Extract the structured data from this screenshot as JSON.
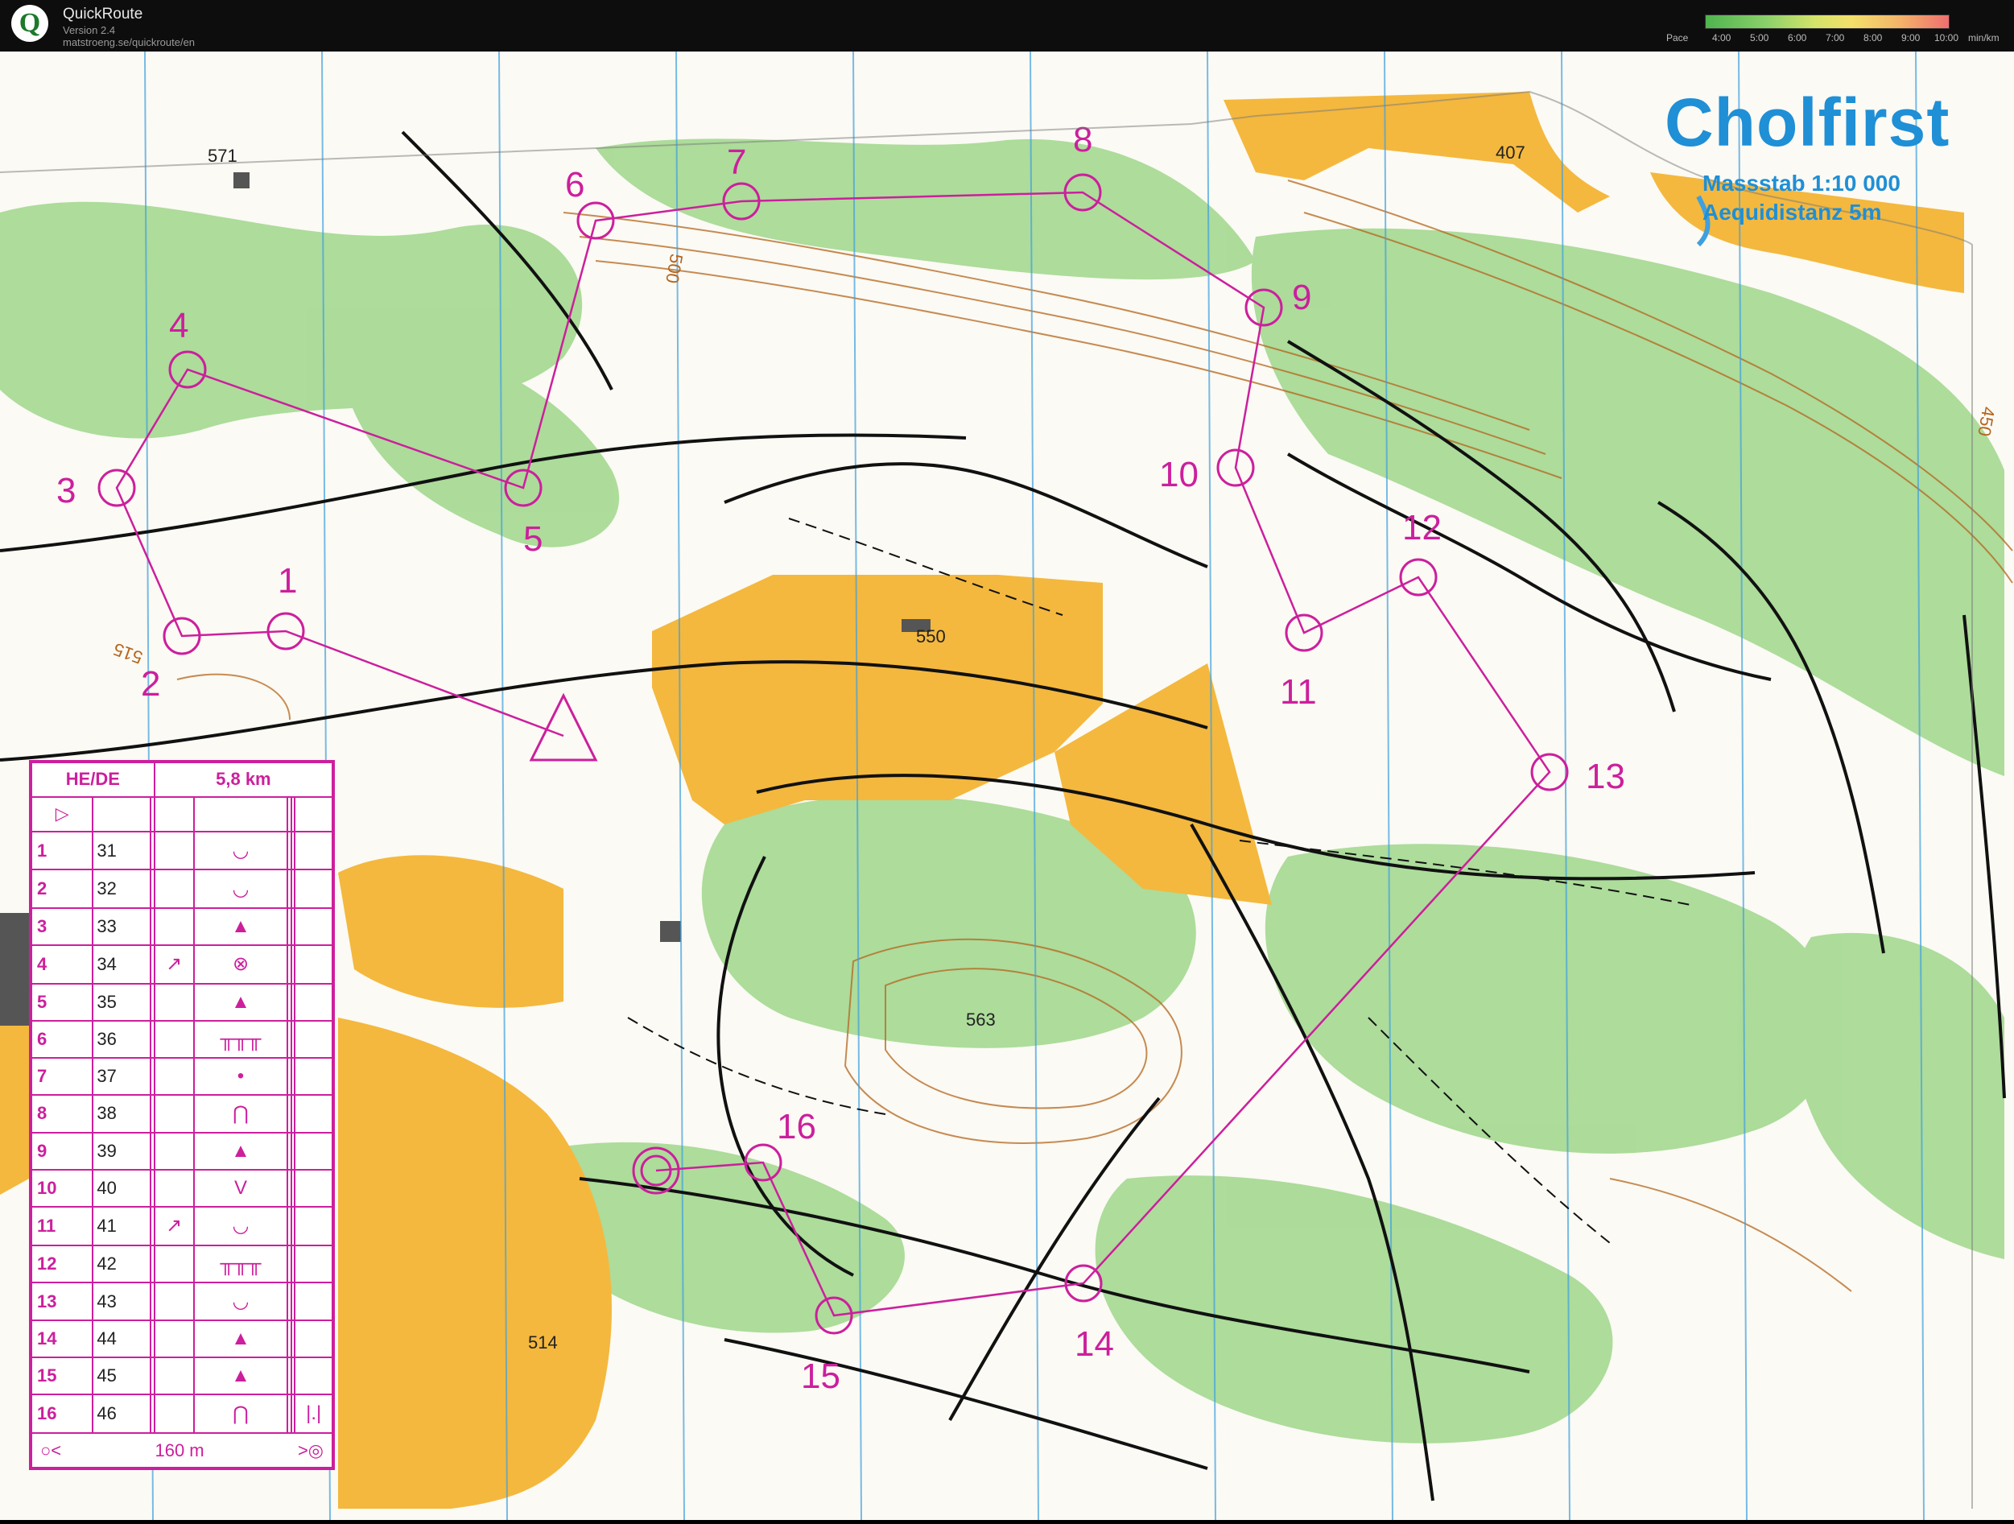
{
  "app": {
    "name": "QuickRoute",
    "version": "Version 2.4",
    "url": "matstroeng.se/quickroute/en",
    "logo_letter": "Q"
  },
  "pace_legend": {
    "label": "Pace",
    "ticks": [
      "4:00",
      "5:00",
      "6:00",
      "7:00",
      "8:00",
      "9:00",
      "10:00"
    ],
    "unit": "min/km"
  },
  "map": {
    "title": "Cholfirst",
    "scale": "Massstab     1:10 000",
    "contour": "Aequidistanz 5m",
    "spot_heights": [
      "571",
      "407",
      "550",
      "563",
      "514",
      "500",
      "515",
      "450"
    ],
    "control_labels": [
      "1",
      "2",
      "3",
      "4",
      "5",
      "6",
      "7",
      "8",
      "9",
      "10",
      "11",
      "12",
      "13",
      "14",
      "15",
      "16"
    ],
    "colors": {
      "course": "#cc1f9d",
      "forest": "#8fcf7a",
      "field": "#f3b53c",
      "contour": "#b5651d",
      "magnetic_north": "#3fa0e0"
    }
  },
  "description": {
    "class": "HE/DE",
    "length": "5,8 km",
    "start_symbol": "▷",
    "rows": [
      {
        "num": "1",
        "code": "31",
        "dir": "",
        "feature": "◡"
      },
      {
        "num": "2",
        "code": "32",
        "dir": "",
        "feature": "◡"
      },
      {
        "num": "3",
        "code": "33",
        "dir": "",
        "feature": "▲"
      },
      {
        "num": "4",
        "code": "34",
        "dir": "↗",
        "feature": "⊗"
      },
      {
        "num": "5",
        "code": "35",
        "dir": "",
        "feature": "▲"
      },
      {
        "num": "6",
        "code": "36",
        "dir": "",
        "feature": "╥╥╥"
      },
      {
        "num": "7",
        "code": "37",
        "dir": "",
        "feature": "•"
      },
      {
        "num": "8",
        "code": "38",
        "dir": "",
        "feature": "⋂"
      },
      {
        "num": "9",
        "code": "39",
        "dir": "",
        "feature": "▲"
      },
      {
        "num": "10",
        "code": "40",
        "dir": "",
        "feature": "V"
      },
      {
        "num": "11",
        "code": "41",
        "dir": "↗",
        "feature": "◡"
      },
      {
        "num": "12",
        "code": "42",
        "dir": "",
        "feature": "╥╥╥"
      },
      {
        "num": "13",
        "code": "43",
        "dir": "",
        "feature": "◡"
      },
      {
        "num": "14",
        "code": "44",
        "dir": "",
        "feature": "▲"
      },
      {
        "num": "15",
        "code": "45",
        "dir": "",
        "feature": "▲"
      },
      {
        "num": "16",
        "code": "46",
        "dir": "",
        "feature": "⋂",
        "extra": "|.|"
      }
    ],
    "finish_distance": "160 m"
  }
}
